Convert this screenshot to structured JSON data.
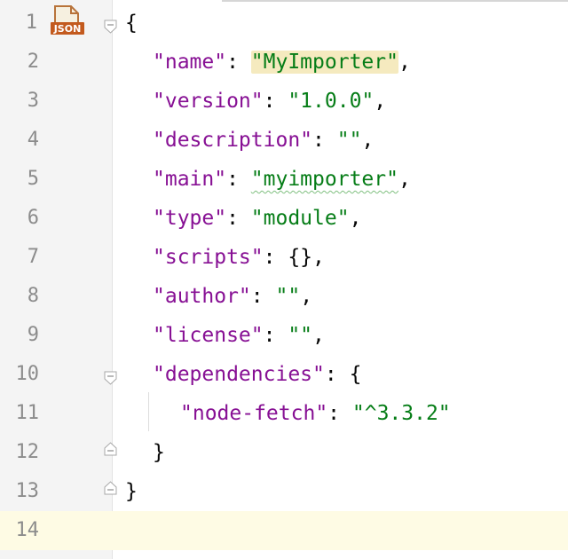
{
  "file_icon": {
    "name": "json-file-icon",
    "label": "JSON"
  },
  "colors": {
    "key": "#871094",
    "string": "#067d17",
    "line_number": "#8c8c8c",
    "current_line": "#fefbe4",
    "gutter": "#f4f4f4",
    "highlight": "#f5eabf"
  },
  "lines": [
    {
      "num": "1",
      "code": {
        "open": "{"
      }
    },
    {
      "num": "2",
      "code": {
        "key": "\"name\"",
        "sep": ": ",
        "value": "\"MyImporter\"",
        "end": ","
      }
    },
    {
      "num": "3",
      "code": {
        "key": "\"version\"",
        "sep": ": ",
        "value": "\"1.0.0\"",
        "end": ","
      }
    },
    {
      "num": "4",
      "code": {
        "key": "\"description\"",
        "sep": ": ",
        "value": "\"\"",
        "end": ","
      }
    },
    {
      "num": "5",
      "code": {
        "key": "\"main\"",
        "sep": ": ",
        "value": "\"myimporter\"",
        "end": ","
      }
    },
    {
      "num": "6",
      "code": {
        "key": "\"type\"",
        "sep": ": ",
        "value": "\"module\"",
        "end": ","
      }
    },
    {
      "num": "7",
      "code": {
        "key": "\"scripts\"",
        "sep": ": ",
        "value": "{}",
        "end": ","
      }
    },
    {
      "num": "8",
      "code": {
        "key": "\"author\"",
        "sep": ": ",
        "value": "\"\"",
        "end": ","
      }
    },
    {
      "num": "9",
      "code": {
        "key": "\"license\"",
        "sep": ": ",
        "value": "\"\"",
        "end": ","
      }
    },
    {
      "num": "10",
      "code": {
        "key": "\"dependencies\"",
        "sep": ": ",
        "value": "{"
      }
    },
    {
      "num": "11",
      "code": {
        "key": "\"node-fetch\"",
        "sep": ": ",
        "value": "\"^3.3.2\""
      }
    },
    {
      "num": "12",
      "code": {
        "close": "}"
      }
    },
    {
      "num": "13",
      "code": {
        "close": "}"
      }
    },
    {
      "num": "14",
      "code": {}
    }
  ]
}
